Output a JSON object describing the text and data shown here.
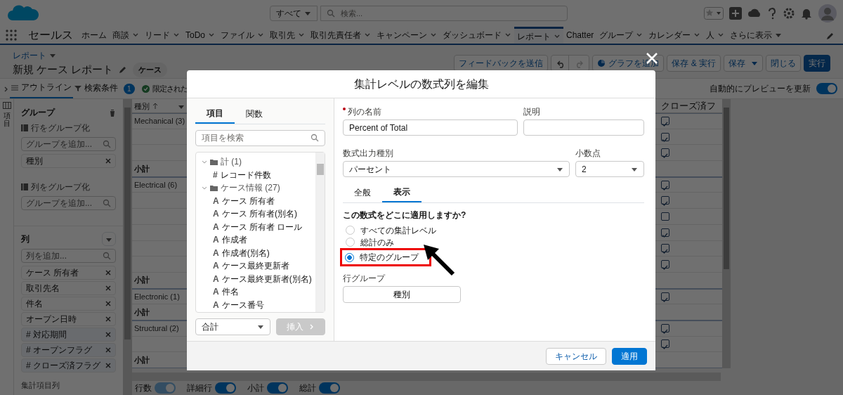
{
  "app_header": {
    "search_scope": "すべて",
    "search_placeholder": "検索..."
  },
  "nav": {
    "app_name": "セールス",
    "items": [
      {
        "label": "ホーム",
        "dropdown": false,
        "selected": false
      },
      {
        "label": "商談",
        "dropdown": true,
        "selected": false
      },
      {
        "label": "リード",
        "dropdown": true,
        "selected": false
      },
      {
        "label": "ToDo",
        "dropdown": true,
        "selected": false
      },
      {
        "label": "ファイル",
        "dropdown": true,
        "selected": false
      },
      {
        "label": "取引先",
        "dropdown": true,
        "selected": false
      },
      {
        "label": "取引先責任者",
        "dropdown": true,
        "selected": false
      },
      {
        "label": "キャンペーン",
        "dropdown": true,
        "selected": false
      },
      {
        "label": "ダッシュボード",
        "dropdown": true,
        "selected": false
      },
      {
        "label": "レポート",
        "dropdown": true,
        "selected": true
      },
      {
        "label": "Chatter",
        "dropdown": false,
        "selected": false
      },
      {
        "label": "グループ",
        "dropdown": true,
        "selected": false
      },
      {
        "label": "カレンダー",
        "dropdown": true,
        "selected": false
      },
      {
        "label": "人",
        "dropdown": true,
        "selected": false
      }
    ],
    "more": "さらに表示"
  },
  "report_header": {
    "breadcrumb": "レポート",
    "title": "新規 ケース レポート",
    "type_badge": "ケース",
    "buttons": [
      {
        "kind": "text",
        "label": "フィードバックを送信"
      },
      {
        "kind": "undo",
        "disabled": false
      },
      {
        "kind": "redo",
        "disabled": true
      },
      {
        "kind": "chart",
        "label": "グラフを追加"
      },
      {
        "kind": "text",
        "label": "保存 & 実行"
      },
      {
        "kind": "menu",
        "label": "保存"
      },
      {
        "kind": "text",
        "label": "閉じる"
      },
      {
        "kind": "primary",
        "label": "実行"
      }
    ]
  },
  "toolbar": {
    "tabs": [
      {
        "label": "アウトライン",
        "selected": true
      },
      {
        "label": "検索条件",
        "count": "1",
        "selected": false
      }
    ],
    "notice": "限定された",
    "auto_preview": {
      "label": "自動的にプレビューを更新",
      "on": true
    }
  },
  "side_strip": {
    "label": "項目"
  },
  "outline": {
    "groups_title": "グループ",
    "row_group": {
      "label": "行をグループ化",
      "placeholder": "グループを追加...",
      "chips": [
        "種別"
      ]
    },
    "column_group": {
      "label": "列をグループ化",
      "placeholder": "グループを追加..."
    },
    "columns_title": "列",
    "columns_placeholder": "列を追加...",
    "columns": [
      {
        "label": "ケース 所有者",
        "kind": "text"
      },
      {
        "label": "取引先名",
        "kind": "text"
      },
      {
        "label": "件名",
        "kind": "text"
      },
      {
        "label": "オープン日時",
        "kind": "text"
      },
      {
        "label": "# 対応期間",
        "kind": "number"
      },
      {
        "label": "# オープンフラグ",
        "kind": "number"
      },
      {
        "label": "# クローズ済フラグ",
        "kind": "number"
      }
    ],
    "footer": "集計項目列"
  },
  "table": {
    "columns": [
      "種別",
      "クローズ済フ"
    ],
    "groups": [
      {
        "label": "Mechanical (3)",
        "rows": [
          {
            "checked": true
          },
          {
            "checked": true
          },
          {
            "checked": true
          }
        ],
        "subtotal": "小計"
      },
      {
        "label": "Electrical (6)",
        "rows": [
          {
            "checked": true
          },
          {
            "checked": true
          },
          {
            "checked": false
          },
          {
            "checked": true
          },
          {
            "checked": true
          },
          {
            "checked": true
          }
        ],
        "subtotal": "小計"
      },
      {
        "label": "Electronic (1)",
        "rows": [
          {
            "checked": true
          }
        ],
        "subtotal": "小計"
      },
      {
        "label": "Structural (2)",
        "rows": [
          {
            "checked": true
          },
          {
            "checked": true
          }
        ],
        "subtotal": "小計"
      }
    ]
  },
  "footer_toggles": [
    {
      "label": "行数",
      "on": true,
      "disabled": true
    },
    {
      "label": "詳細行",
      "on": true,
      "disabled": false
    },
    {
      "label": "小計",
      "on": true,
      "disabled": false
    },
    {
      "label": "総計",
      "on": true,
      "disabled": false
    }
  ],
  "modal": {
    "title": "集計レベルの数式列を編集",
    "field_tabs": [
      {
        "label": "項目",
        "selected": true
      },
      {
        "label": "関数",
        "selected": false
      }
    ],
    "field_search_placeholder": "項目を検索",
    "tree": [
      {
        "label": "計 (1)",
        "expanded": true,
        "children": [
          {
            "icon": "#",
            "label": "レコード件数"
          }
        ]
      },
      {
        "label": "ケース情報 (27)",
        "expanded": true,
        "children": [
          {
            "icon": "A",
            "label": "ケース 所有者"
          },
          {
            "icon": "A",
            "label": "ケース 所有者(別名)"
          },
          {
            "icon": "A",
            "label": "ケース 所有者 ロール"
          },
          {
            "icon": "A",
            "label": "作成者"
          },
          {
            "icon": "A",
            "label": "作成者(別名)"
          },
          {
            "icon": "A",
            "label": "ケース最終更新者"
          },
          {
            "icon": "A",
            "label": "ケース最終更新者(別名)"
          },
          {
            "icon": "A",
            "label": "件名"
          },
          {
            "icon": "A",
            "label": "ケース番号"
          }
        ]
      }
    ],
    "summary_select": "合計",
    "insert_button": {
      "label": "挿入",
      "disabled": true
    },
    "name_label": "列の名前",
    "name_required": true,
    "name_value": "Percent of Total",
    "description_label": "説明",
    "output_type_label": "数式出力種別",
    "output_type_value": "パーセント",
    "decimals_label": "小数点",
    "decimals_value": "2",
    "tabs": [
      {
        "label": "全般",
        "selected": false
      },
      {
        "label": "表示",
        "selected": true
      }
    ],
    "question": "この数式をどこに適用しますか?",
    "options": [
      {
        "label": "すべての集計レベル",
        "selected": false,
        "highlighted": false
      },
      {
        "label": "総計のみ",
        "selected": false,
        "highlighted": false
      },
      {
        "label": "特定のグループ",
        "selected": true,
        "highlighted": true
      }
    ],
    "row_group_label": "行グループ",
    "row_group_value": "種別",
    "cancel": "キャンセル",
    "apply": "適用"
  }
}
